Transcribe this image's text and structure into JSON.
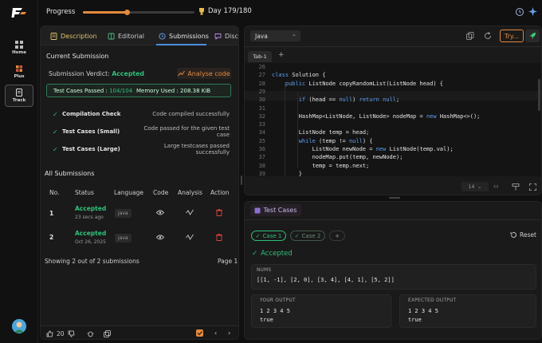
{
  "nav": {
    "items": [
      {
        "label": "Home"
      },
      {
        "label": "Plus"
      },
      {
        "label": "Track"
      }
    ]
  },
  "topbar": {
    "progress_label": "Progress",
    "progress_fraction": 0.39,
    "day_label": "Day 179/180"
  },
  "left_tabs": {
    "description": "Description",
    "editorial": "Editorial",
    "submissions": "Submissions",
    "discuss": "Disc"
  },
  "current_submission": {
    "title": "Current Submission",
    "verdict_label": "Submission Verdict:",
    "verdict_value": "Accepted",
    "analyse_label": "Analyse code",
    "test_cases_label": "Test Cases Passed :",
    "test_cases_value": "104/104",
    "memory_label": "Memory Used :",
    "memory_value": "208.38 KiB",
    "checks": [
      {
        "name": "Compilation Check",
        "desc": "Code compiled successfully"
      },
      {
        "name": "Test Cases (Small)",
        "desc": "Code passed for the given test case"
      },
      {
        "name": "Test Cases (Large)",
        "desc": "Large testcases passed successfully"
      }
    ]
  },
  "all_submissions": {
    "title": "All Submissions",
    "headers": [
      "No.",
      "Status",
      "Language",
      "Code",
      "Analysis",
      "Action"
    ],
    "rows": [
      {
        "no": "1",
        "status": "Accepted",
        "time": "23 secs ago",
        "lang": "java"
      },
      {
        "no": "2",
        "status": "Accepted",
        "time": "Oct 26, 2025",
        "lang": "java"
      }
    ],
    "summary": "Showing 2 out of 2 submissions",
    "page": "Page 1"
  },
  "footer": {
    "likes": "20"
  },
  "editor": {
    "language": "Java",
    "try_label": "Try...",
    "tab_label": "Tab-1",
    "lines": [
      {
        "n": "26",
        "t": ""
      },
      {
        "n": "27",
        "t": "class Solution {"
      },
      {
        "n": "28",
        "t": "    public ListNode copyRandomList(ListNode head) {"
      },
      {
        "n": "29",
        "t": ""
      },
      {
        "n": "30",
        "t": "        if (head == null) return null;"
      },
      {
        "n": "31",
        "t": ""
      },
      {
        "n": "32",
        "t": "        HashMap<ListNode, ListNode> nodeMap = new HashMap<>();"
      },
      {
        "n": "33",
        "t": ""
      },
      {
        "n": "34",
        "t": "        ListNode temp = head;"
      },
      {
        "n": "35",
        "t": "        while (temp != null) {"
      },
      {
        "n": "36",
        "t": "            ListNode newNode = new ListNode(temp.val);"
      },
      {
        "n": "37",
        "t": "            nodeMap.put(temp, newNode);"
      },
      {
        "n": "38",
        "t": "            temp = temp.next;"
      },
      {
        "n": "39",
        "t": "        }"
      }
    ],
    "font_size": "14"
  },
  "testpanel": {
    "tab_label": "Test Cases",
    "case1": "Case 1",
    "case2": "Case 2",
    "add": "+",
    "reset": "Reset",
    "result": "Accepted",
    "nums_label": "NUMS",
    "nums_value": "[[1, -1], [2, 0], [3, 4], [4, 1], [5, 2]]",
    "your_output_label": "YOUR OUTPUT",
    "your_output_l1": "1 2 3 4 5",
    "your_output_l2": "true",
    "expected_label": "EXPECTED OUTPUT",
    "expected_l1": "1 2 3 4 5",
    "expected_l2": "true"
  },
  "colors": {
    "accent": "#e5893c",
    "accepted": "#2fc07a",
    "tab_active": "#4c8fe0"
  }
}
